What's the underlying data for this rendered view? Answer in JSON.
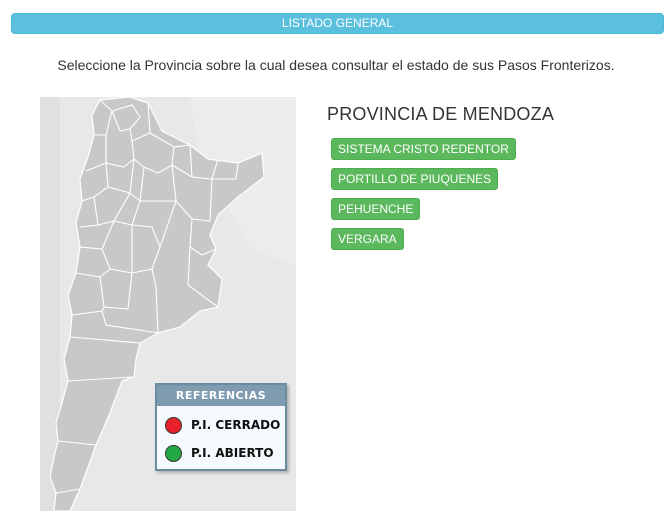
{
  "header": {
    "title": "LISTADO GENERAL"
  },
  "instruction": "Seleccione la Provincia sobre la cual desea consultar el estado de sus Pasos Fronterizos.",
  "province": {
    "title": "PROVINCIA DE MENDOZA"
  },
  "passes": [
    {
      "label": "SISTEMA CRISTO REDENTOR"
    },
    {
      "label": "PORTILLO DE PIUQUENES"
    },
    {
      "label": "PEHUENCHE"
    },
    {
      "label": "VERGARA"
    }
  ],
  "legend": {
    "title": "REFERENCIAS",
    "items": [
      {
        "label": "P.I. CERRADO",
        "color": "#e8222b"
      },
      {
        "label": "P.I. ABIERTO",
        "color": "#22a845"
      }
    ]
  },
  "colors": {
    "header_bg": "#5bc0de",
    "button_bg": "#5cb85c",
    "map_fill": "#c8c8c8",
    "neighbor_fill": "#e8e8e8"
  }
}
